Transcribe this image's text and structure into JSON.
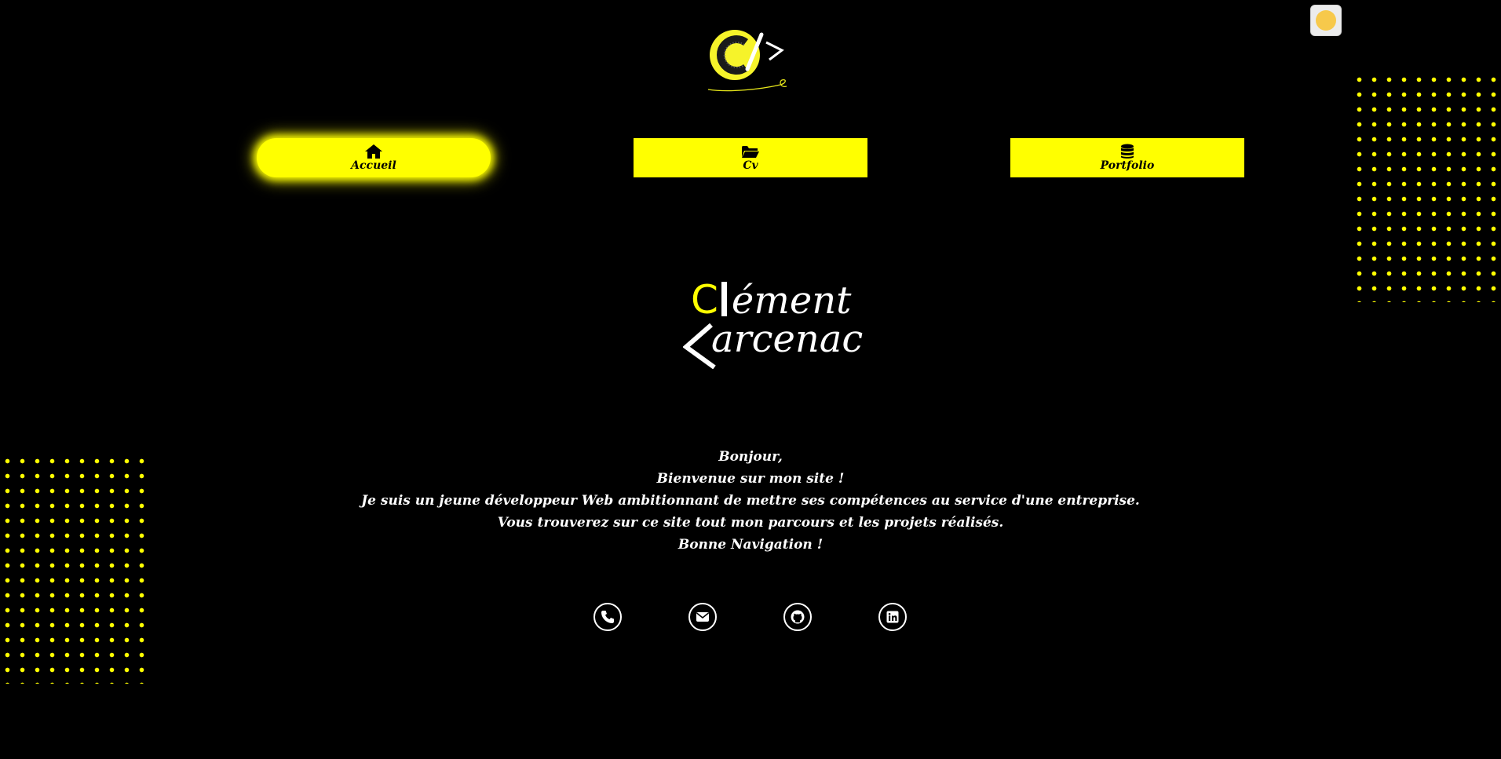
{
  "nav": {
    "items": [
      {
        "label": "Accueil",
        "icon": "home-icon"
      },
      {
        "label": "Cv",
        "icon": "folder-open-icon"
      },
      {
        "label": "Portfolio",
        "icon": "database-icon"
      }
    ],
    "active": "Accueil"
  },
  "hero": {
    "name_line1_first": "C",
    "name_line1_rest": "ément",
    "name_line2_rest": "arcenac"
  },
  "intro": {
    "lines": [
      "Bonjour,",
      "Bienvenue sur mon site !",
      "Je suis un jeune développeur Web ambitionnant de mettre ses compétences au service d'une entreprise.",
      "Vous trouverez sur ce site tout mon parcours et les projets réalisés.",
      "Bonne Navigation !"
    ]
  },
  "social": [
    "phone-icon",
    "mail-icon",
    "github-icon",
    "linkedin-icon"
  ],
  "colors": {
    "accent": "#ffff00",
    "background": "#000000",
    "text": "#ffffff"
  }
}
